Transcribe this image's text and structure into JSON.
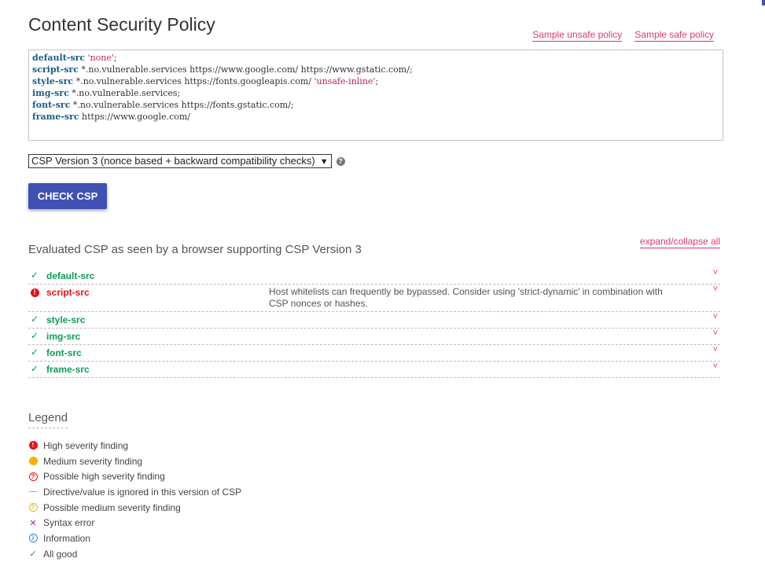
{
  "page": {
    "title": "Content Security Policy",
    "links": {
      "unsafe": "Sample unsafe policy",
      "safe": "Sample safe policy"
    }
  },
  "policy": {
    "lines": [
      {
        "directive": "default-src",
        "values": [
          {
            "text": "'none'",
            "style": "str"
          }
        ],
        "end": ";"
      },
      {
        "directive": "script-src",
        "values": [
          {
            "text": "*.no.vulnerable.services https://www.google.com/ https://www.gstatic.com/",
            "style": "plain"
          }
        ],
        "end": ";"
      },
      {
        "directive": "style-src",
        "values": [
          {
            "text": "*.no.vulnerable.services https://fonts.googleapis.com/",
            "style": "plain"
          },
          {
            "text": "'unsafe-inline'",
            "style": "str"
          }
        ],
        "end": ";"
      },
      {
        "directive": "img-src",
        "values": [
          {
            "text": "*.no.vulnerable.services",
            "style": "plain"
          }
        ],
        "end": ";"
      },
      {
        "directive": "font-src",
        "values": [
          {
            "text": "*.no.vulnerable.services https://fonts.gstatic.com/",
            "style": "plain"
          }
        ],
        "end": ";"
      },
      {
        "directive": "frame-src",
        "values": [
          {
            "text": "https://www.google.com/",
            "style": "plain"
          }
        ],
        "end": ""
      }
    ]
  },
  "version": {
    "selected": "CSP Version 3 (nonce based + backward compatibility checks)",
    "help_icon": "question-circle-icon"
  },
  "check_button": "CHECK CSP",
  "evaluation": {
    "title": "Evaluated CSP as seen by a browser supporting CSP Version 3",
    "expand_collapse": "expand/collapse all",
    "directives": [
      {
        "name": "default-src",
        "status": "good",
        "message": ""
      },
      {
        "name": "script-src",
        "status": "high",
        "message": "Host whitelists can frequently be bypassed. Consider using 'strict-dynamic' in combination with CSP nonces or hashes."
      },
      {
        "name": "style-src",
        "status": "good",
        "message": ""
      },
      {
        "name": "img-src",
        "status": "good",
        "message": ""
      },
      {
        "name": "font-src",
        "status": "good",
        "message": ""
      },
      {
        "name": "frame-src",
        "status": "good",
        "message": ""
      }
    ]
  },
  "legend": {
    "title": "Legend",
    "items": [
      {
        "label": "High severity finding",
        "icon": "high-severity-icon",
        "color": "#e8101a"
      },
      {
        "label": "Medium severity finding",
        "icon": "medium-severity-icon",
        "color": "#f5b400"
      },
      {
        "label": "Possible high severity finding",
        "icon": "possible-high-severity-icon",
        "color": "#e8101a"
      },
      {
        "label": "Directive/value is ignored in this version of CSP",
        "icon": "ignored-dash-icon",
        "color": "#777777"
      },
      {
        "label": "Possible medium severity finding",
        "icon": "possible-medium-severity-icon",
        "color": "#f5b400"
      },
      {
        "label": "Syntax error",
        "icon": "syntax-error-x-icon",
        "color": "#9c27b0"
      },
      {
        "label": "Information",
        "icon": "information-icon",
        "color": "#2a7de1"
      },
      {
        "label": "All good",
        "icon": "all-good-check-icon",
        "color": "#0f9d58"
      }
    ]
  },
  "colors": {
    "accent": "#3f51b5",
    "link": "#e53279",
    "good": "#0f9d58",
    "high": "#e8101a"
  }
}
